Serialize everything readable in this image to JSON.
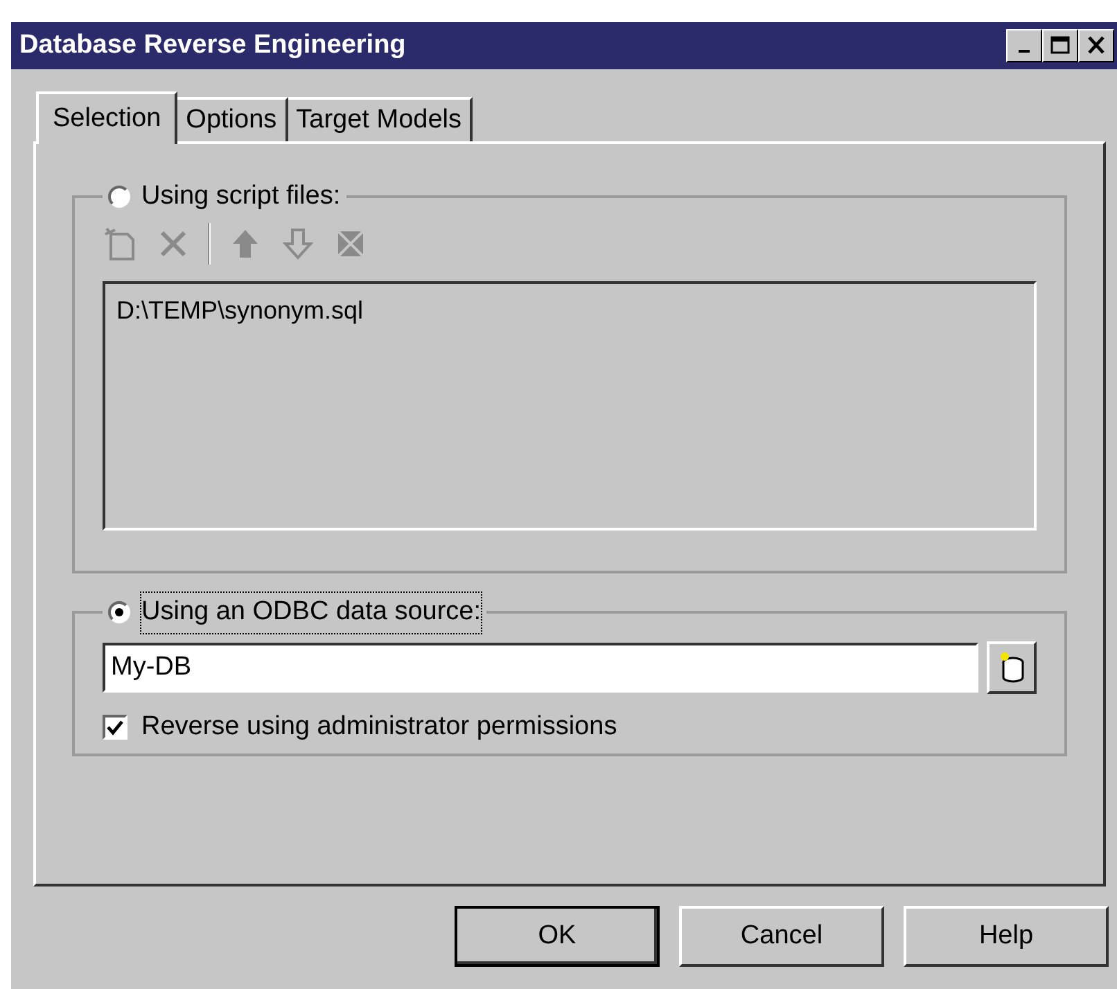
{
  "window": {
    "title": "Database Reverse  Engineering"
  },
  "tabs": [
    {
      "label": "Selection",
      "selected": true
    },
    {
      "label": "Options",
      "selected": false
    },
    {
      "label": "Target Models",
      "selected": false
    }
  ],
  "sources": [
    {
      "kind": "script",
      "label": "Using script files:",
      "selected": false,
      "toolbar_disabled": true,
      "files": [
        "D:\\TEMP\\synonym.sql"
      ]
    },
    {
      "kind": "odbc",
      "label": "Using an ODBC data source:",
      "selected": true,
      "value": "My-DB",
      "option": {
        "label": "Reverse using administrator permissions",
        "checked": true
      }
    }
  ],
  "buttons": [
    {
      "label": "OK",
      "default": true
    },
    {
      "label": "Cancel",
      "default": false
    },
    {
      "label": "Help",
      "default": false
    }
  ]
}
